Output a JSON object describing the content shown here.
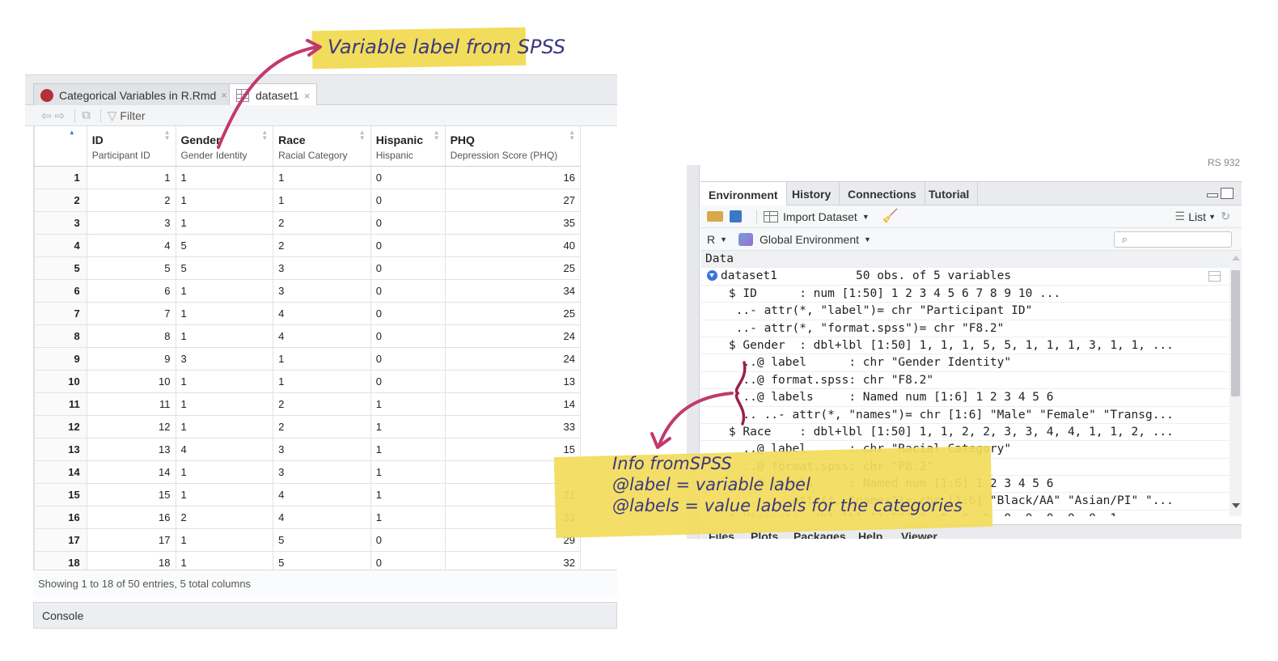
{
  "editor_tabs": [
    {
      "label": "Categorical Variables in R.Rmd",
      "close": "×"
    },
    {
      "label": "dataset1",
      "close": "×"
    }
  ],
  "viewer_toolbar": {
    "filter_label": "Filter"
  },
  "table": {
    "columns": [
      {
        "name": "ID",
        "label": "Participant ID"
      },
      {
        "name": "Gender",
        "label": "Gender Identity"
      },
      {
        "name": "Race",
        "label": "Racial Category"
      },
      {
        "name": "Hispanic",
        "label": "Hispanic"
      },
      {
        "name": "PHQ",
        "label": "Depression Score (PHQ)"
      }
    ],
    "rows": [
      [
        "1",
        "1",
        "1",
        "1",
        "0",
        "16"
      ],
      [
        "2",
        "2",
        "1",
        "1",
        "0",
        "27"
      ],
      [
        "3",
        "3",
        "1",
        "2",
        "0",
        "35"
      ],
      [
        "4",
        "4",
        "5",
        "2",
        "0",
        "40"
      ],
      [
        "5",
        "5",
        "5",
        "3",
        "0",
        "25"
      ],
      [
        "6",
        "6",
        "1",
        "3",
        "0",
        "34"
      ],
      [
        "7",
        "7",
        "1",
        "4",
        "0",
        "25"
      ],
      [
        "8",
        "8",
        "1",
        "4",
        "0",
        "24"
      ],
      [
        "9",
        "9",
        "3",
        "1",
        "0",
        "24"
      ],
      [
        "10",
        "10",
        "1",
        "1",
        "0",
        "13"
      ],
      [
        "11",
        "11",
        "1",
        "2",
        "1",
        "14"
      ],
      [
        "12",
        "12",
        "1",
        "2",
        "1",
        "33"
      ],
      [
        "13",
        "13",
        "4",
        "3",
        "1",
        "15"
      ],
      [
        "14",
        "14",
        "1",
        "3",
        "1",
        ""
      ],
      [
        "15",
        "15",
        "1",
        "4",
        "1",
        "21"
      ],
      [
        "16",
        "16",
        "2",
        "4",
        "1",
        "33"
      ],
      [
        "17",
        "17",
        "1",
        "5",
        "0",
        "29"
      ],
      [
        "18",
        "18",
        "1",
        "5",
        "0",
        "32"
      ]
    ]
  },
  "status_text": "Showing 1 to 18 of 50 entries, 5 total columns",
  "console_label": "Console",
  "env": {
    "project_label": "RS 932",
    "tabs": [
      "Environment",
      "History",
      "Connections",
      "Tutorial"
    ],
    "import_label": "Import Dataset",
    "list_label": "List",
    "r_label": "R",
    "scope_label": "Global Environment",
    "search_placeholder": "",
    "section_label": "Data",
    "dataset_name": "dataset1",
    "dataset_summary": "50 obs. of 5 variables",
    "lines": [
      "    $ ID      : num [1:50] 1 2 3 4 5 6 7 8 9 10 ...",
      "     ..- attr(*, \"label\")= chr \"Participant ID\"",
      "     ..- attr(*, \"format.spss\")= chr \"F8.2\"",
      "    $ Gender  : dbl+lbl [1:50] 1, 1, 1, 5, 5, 1, 1, 1, 3, 1, 1, ...",
      "      ..@ label      : chr \"Gender Identity\"",
      "      ..@ format.spss: chr \"F8.2\"",
      "      ..@ labels     : Named num [1:6] 1 2 3 4 5 6",
      "      .. ..- attr(*, \"names\")= chr [1:6] \"Male\" \"Female\" \"Transg...",
      "    $ Race    : dbl+lbl [1:50] 1, 1, 2, 2, 3, 3, 4, 4, 1, 1, 2, ...",
      "      ..@ label      : chr \"Racial Category\"",
      "      ..@ format.spss: chr \"F8.2\"",
      "      ..@ labels     : Named num [1:6] 1 2 3 4 5 6",
      "      .. ..- attr(*, \"names\")= chr [1:6] \"Black/AA\" \"Asian/PI\" \"...",
      "    $ Hispanic: dbl+lbl [1:50] 0, 0, 0, 0, 0, 0, 0, 0, 0, 1, ..."
    ],
    "bottom_tabs": [
      "Files",
      "Plots",
      "Packages",
      "Help",
      "Viewer"
    ]
  },
  "annotations": {
    "top_note": "Variable label from SPSS",
    "info_lines": [
      "Info fromSPSS",
      "@label = variable label",
      "@labels = value labels for the categories"
    ],
    "highlight_color": "#f2dc5b",
    "arrow_color": "#c2396e"
  }
}
